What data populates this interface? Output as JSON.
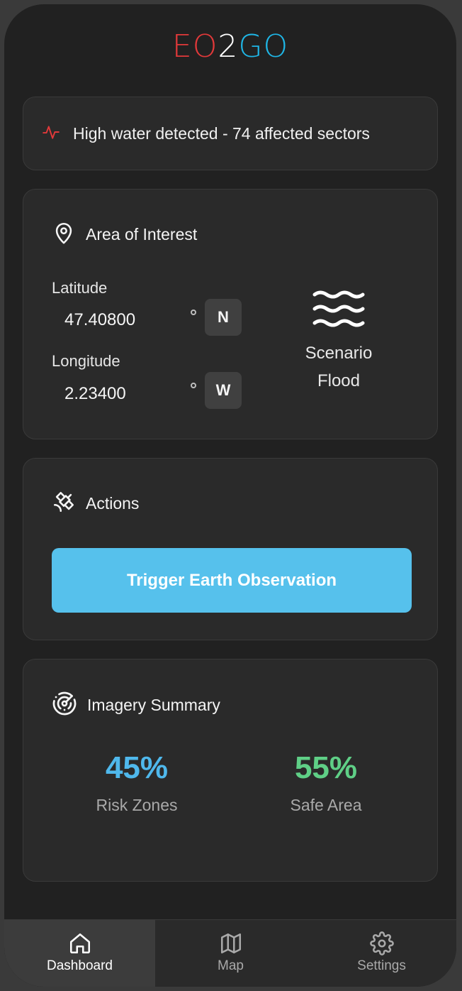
{
  "logo": {
    "letters": [
      "E",
      "O",
      "2",
      "G",
      "O"
    ],
    "colors": [
      "#e2393a",
      "#e2393a",
      "#ffffff",
      "#1fb6e6",
      "#1fb6e6"
    ]
  },
  "alert": {
    "icon": "activity-icon",
    "text": "High water detected - 74 affected sectors",
    "color": "#e2393a"
  },
  "area_of_interest": {
    "icon": "map-pin-icon",
    "title": "Area of Interest",
    "latitude_label": "Latitude",
    "latitude_value": "47.40800",
    "latitude_dir": "N",
    "longitude_label": "Longitude",
    "longitude_value": "2.23400",
    "longitude_dir": "W",
    "scenario_icon": "waves-icon",
    "scenario_label": "Scenario",
    "scenario_value": "Flood"
  },
  "actions": {
    "icon": "satellite-icon",
    "title": "Actions",
    "trigger_label": "Trigger Earth Observation",
    "trigger_color": "#56c1ec"
  },
  "imagery_summary": {
    "icon": "radar-icon",
    "title": "Imagery Summary",
    "risk_value": "45%",
    "risk_label": "Risk Zones",
    "risk_color": "#4fb8ec",
    "safe_value": "55%",
    "safe_label": "Safe Area",
    "safe_color": "#5fcf86"
  },
  "nav": {
    "items": [
      {
        "icon": "home-icon",
        "label": "Dashboard",
        "active": true
      },
      {
        "icon": "map-icon",
        "label": "Map",
        "active": false
      },
      {
        "icon": "settings-icon",
        "label": "Settings",
        "active": false
      }
    ]
  }
}
